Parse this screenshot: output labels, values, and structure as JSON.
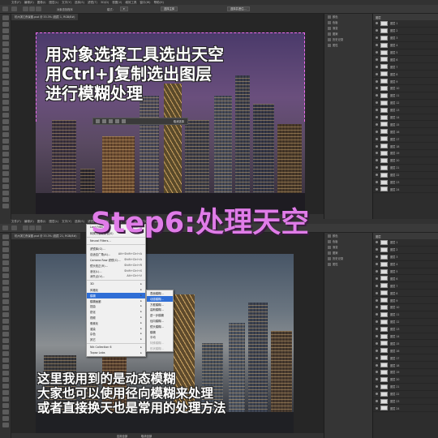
{
  "top": {
    "menus": [
      "文件(F)",
      "编辑(E)",
      "图像(I)",
      "图层(L)",
      "文字(Y)",
      "选择(S)",
      "滤镜(T)",
      "3D(D)",
      "视图(V)",
      "增效工具",
      "窗口(W)",
      "帮助(H)"
    ],
    "options": {
      "mode_label": "对象查找程序",
      "mode_value": "模式:",
      "select_subject": "选择主体",
      "select_and_mask": "选择并遮住..."
    },
    "tab_label": "杭州滨江夜景图.psd @ 33.3% (图层 1, RGB/8#)",
    "selection_bar_label": "取消选择",
    "caption": [
      "用对象选择工具选出天空",
      "用Ctrl+J复制选出图层",
      "进行模糊处理"
    ],
    "dock": [
      "颜色",
      "色板",
      "渐变",
      "图案",
      "历史记录",
      "属性"
    ],
    "layers_header": "图层",
    "layers": [
      "图层 1",
      "图层 2",
      "图层 3",
      "图层 4",
      "图层 5",
      "图层 6",
      "图层 7",
      "图层 8",
      "图层 9",
      "图层 10",
      "图层 11",
      "图层 12",
      "图层 13",
      "图层 14",
      "图层 15",
      "图层 16",
      "图层 17",
      "图层 18",
      "图层 19",
      "图层 20",
      "图层 21",
      "图层 22",
      "图层 23",
      "图层 24"
    ]
  },
  "step_title": "Step6:处理天空",
  "bottom": {
    "tab_label": "杭州滨江夜景图.psd @ 33.3% (图层 21, RGB/8#)",
    "filter_menu": [
      {
        "label": "Last Filter",
        "shortcut": "Alt+Ctrl+F"
      },
      {
        "label": "转换为智能滤镜(S)",
        "shortcut": ""
      },
      {
        "sep": true
      },
      {
        "label": "Neural Filters...",
        "shortcut": ""
      },
      {
        "sep": true
      },
      {
        "label": "滤镜库(G)...",
        "shortcut": ""
      },
      {
        "label": "自适应广角(A)...",
        "shortcut": "Alt+Shift+Ctrl+A"
      },
      {
        "label": "Camera Raw 滤镜(C)...",
        "shortcut": "Shift+Ctrl+A"
      },
      {
        "label": "镜头校正(R)...",
        "shortcut": "Shift+Ctrl+R"
      },
      {
        "label": "液化(L)...",
        "shortcut": "Shift+Ctrl+X"
      },
      {
        "label": "消失点(V)...",
        "shortcut": "Alt+Ctrl+V"
      },
      {
        "sep": true
      },
      {
        "label": "3D",
        "shortcut": "▸"
      },
      {
        "label": "风格化",
        "shortcut": "▸"
      },
      {
        "label": "模糊",
        "shortcut": "▸",
        "hl": true
      },
      {
        "label": "模糊画廊",
        "shortcut": "▸"
      },
      {
        "label": "扭曲",
        "shortcut": "▸"
      },
      {
        "label": "锐化",
        "shortcut": "▸"
      },
      {
        "label": "视频",
        "shortcut": "▸"
      },
      {
        "label": "像素化",
        "shortcut": "▸"
      },
      {
        "label": "渲染",
        "shortcut": "▸"
      },
      {
        "label": "杂色",
        "shortcut": "▸"
      },
      {
        "label": "其它",
        "shortcut": "▸"
      },
      {
        "sep": true
      },
      {
        "label": "Nik Collection 6",
        "shortcut": "▸"
      },
      {
        "label": "Topaz Labs",
        "shortcut": "▸"
      }
    ],
    "blur_menu": [
      {
        "label": "表面模糊...",
        "dim": false
      },
      {
        "label": "动感模糊...",
        "hl": true
      },
      {
        "label": "方框模糊...",
        "dim": false
      },
      {
        "label": "高斯模糊...",
        "dim": false
      },
      {
        "label": "进一步模糊",
        "dim": false
      },
      {
        "label": "径向模糊...",
        "dim": false
      },
      {
        "label": "镜头模糊...",
        "dim": false
      },
      {
        "label": "模糊",
        "dim": false
      },
      {
        "label": "平均",
        "dim": false
      },
      {
        "label": "特殊模糊...",
        "dim": true
      },
      {
        "label": "形状模糊...",
        "dim": true
      }
    ],
    "caption": [
      "这里我用到的是动态模糊",
      "大家也可以使用径向模糊来处理",
      "或者直接换天也是常用的处理方法"
    ],
    "layers": [
      "图层 1",
      "图层 2",
      "图层 3",
      "图层 4",
      "图层 5",
      "图层 6",
      "图层 7",
      "图层 8",
      "图层 9",
      "图层 10",
      "图层 11",
      "图层 12",
      "图层 13",
      "图层 14",
      "图层 15",
      "图层 16",
      "图层 17",
      "图层 18",
      "图层 19",
      "图层 20",
      "图层 21",
      "图层 22",
      "图层 23",
      "图层 24"
    ],
    "status_buttons": [
      "应用全部",
      "取消全部"
    ]
  }
}
